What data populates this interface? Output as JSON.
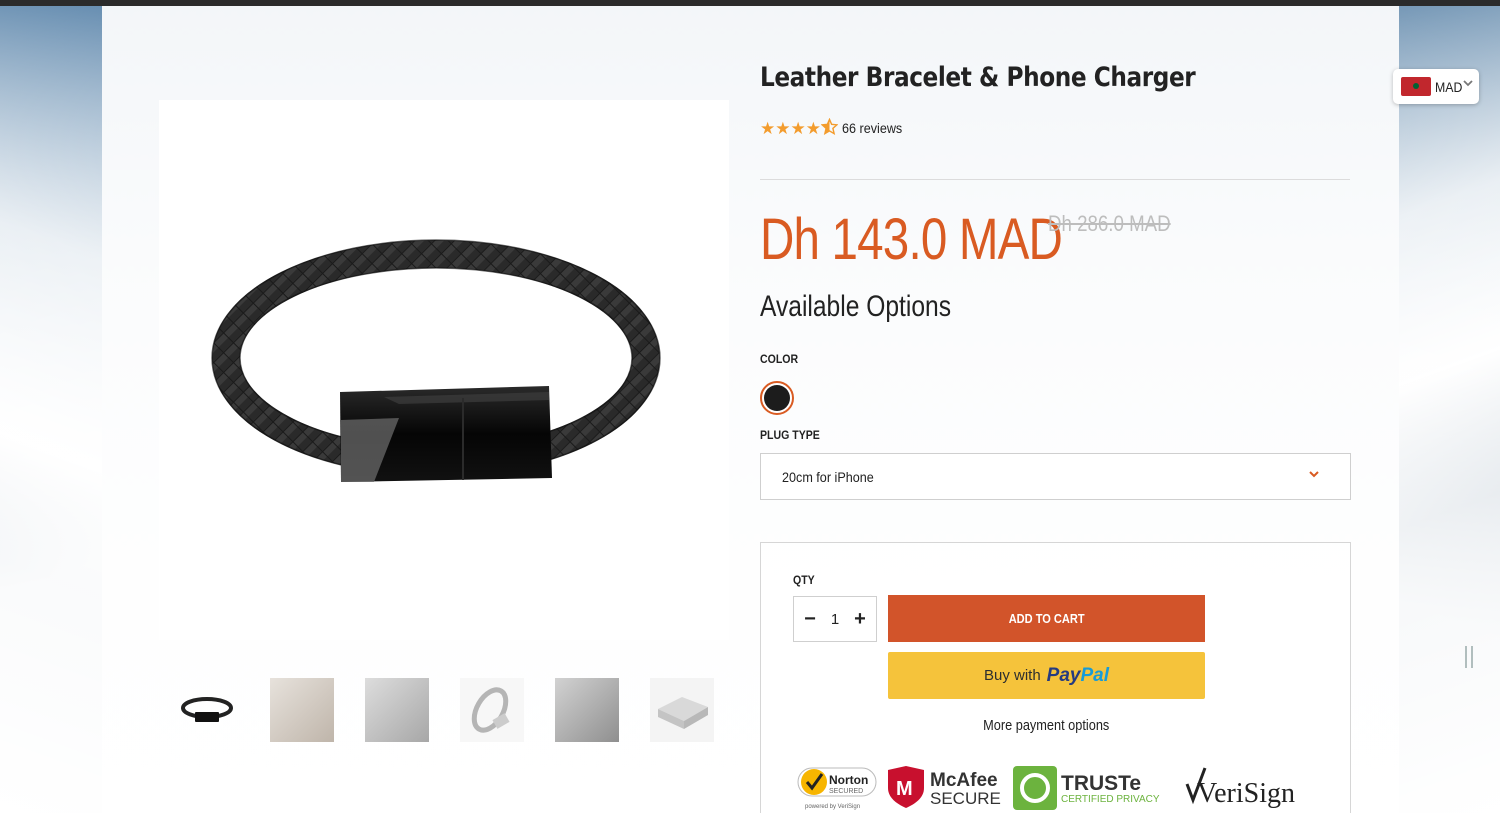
{
  "product": {
    "title": "Leather Bracelet & Phone Charger",
    "rating": 4.5,
    "reviews_label": "66 reviews",
    "price": "Dh 143.0 MAD",
    "compare_price": "Dh 286.0 MAD"
  },
  "options": {
    "heading": "Available Options",
    "color_label": "COLOR",
    "selected_color": "#1c1c1c",
    "plug_label": "PLUG TYPE",
    "plug_value": "20cm for iPhone"
  },
  "buy": {
    "qty_label": "QTY",
    "qty_value": "1",
    "add_to_cart": "ADD TO CART",
    "paypal_prefix": "Buy with",
    "paypal_logo_1": "Pay",
    "paypal_logo_2": "Pal",
    "more_options": "More payment options"
  },
  "badges": {
    "norton": "Norton",
    "norton_sub": "SECURED",
    "norton_powered": "powered by VeriSign",
    "mcafee": "McAfee",
    "mcafee_sub": "SECURE",
    "truste": "TRUSTe",
    "truste_sub": "CERTIFIED PRIVACY",
    "verisign": "VeriSign"
  },
  "currency": {
    "code": "MAD"
  },
  "icons": {
    "star": "star-icon",
    "half_star": "half-star-icon",
    "chevron": "chevron-down-icon",
    "minus": "minus-icon",
    "plus": "plus-icon"
  },
  "colors": {
    "accent": "#d95b22",
    "add_to_cart_bg": "#d2542a",
    "paypal_bg": "#f5c33b",
    "star": "#f39c2d"
  }
}
